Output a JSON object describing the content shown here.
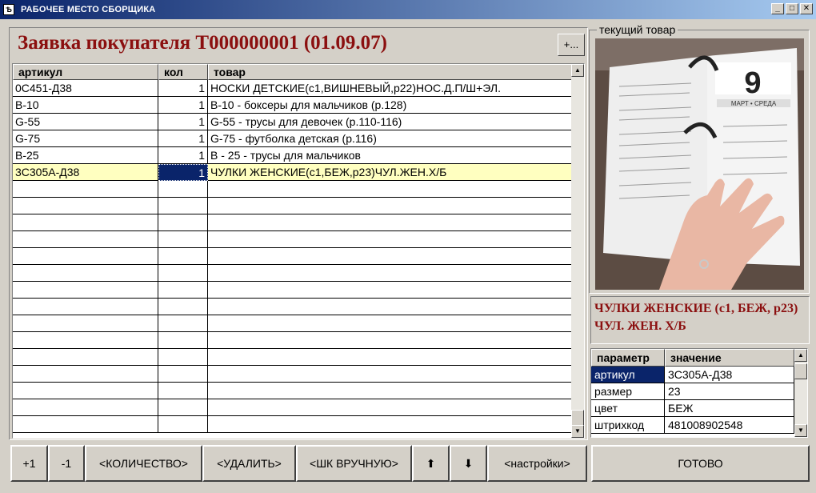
{
  "window": {
    "title": "РАБОЧЕЕ МЕСТО СБОРЩИКА",
    "icon": "app-icon",
    "minimize": "_",
    "maximize": "□",
    "close": "✕"
  },
  "order": {
    "title": "Заявка покупателя Т000000001 (01.09.07)",
    "plus_label": "+..."
  },
  "grid": {
    "columns": [
      "артикул",
      "кол",
      "товар"
    ],
    "rows": [
      [
        "0С451-Д38",
        "1",
        "НОСКИ ДЕТСКИЕ(с1,ВИШНЕВЫЙ,р22)НОС.Д.П/Ш+ЭЛ."
      ],
      [
        "В-10",
        "1",
        "В-10 - боксеры  для мальчиков (р.128)"
      ],
      [
        "G-55",
        "1",
        "G-55 -  трусы для девочек (р.110-116)"
      ],
      [
        "G-75",
        "1",
        "G-75 -  футболка детская (р.116)"
      ],
      [
        "В-25",
        "1",
        "В - 25  - трусы для мальчиков"
      ],
      [
        "3С305А-Д38",
        "1",
        "ЧУЛКИ ЖЕНСКИЕ(с1,БЕЖ,р23)ЧУЛ.ЖЕН.Х/Б"
      ]
    ],
    "selected_index": 5,
    "empty_rows": 15
  },
  "current_item": {
    "group_label": "текущий товар",
    "name": "ЧУЛКИ ЖЕНСКИЕ (с1, БЕЖ, р23) ЧУЛ. ЖЕН. Х/Б",
    "photo_day": "9",
    "photo_month": "МАРТ • СРЕДА"
  },
  "params": {
    "columns": [
      "параметр",
      "значение"
    ],
    "rows": [
      [
        "артикул",
        "3С305А-Д38"
      ],
      [
        "размер",
        "23"
      ],
      [
        "цвет",
        "БЕЖ"
      ],
      [
        "штрихкод",
        "481008902548"
      ]
    ]
  },
  "buttons": {
    "plus_one": "+1",
    "minus_one": "-1",
    "quantity": "<КОЛИЧЕСТВО>",
    "delete": "<УДАЛИТЬ>",
    "manual_barcode": "<ШК ВРУЧНУЮ>",
    "up": "⬆",
    "down": "⬇",
    "settings": "<настройки>",
    "done": "ГОТОВО"
  },
  "colors": {
    "title_bar": "#0a246a",
    "accent_red": "#8b0f0f",
    "selection": "#0a246a",
    "selected_row": "#ffffc0"
  }
}
